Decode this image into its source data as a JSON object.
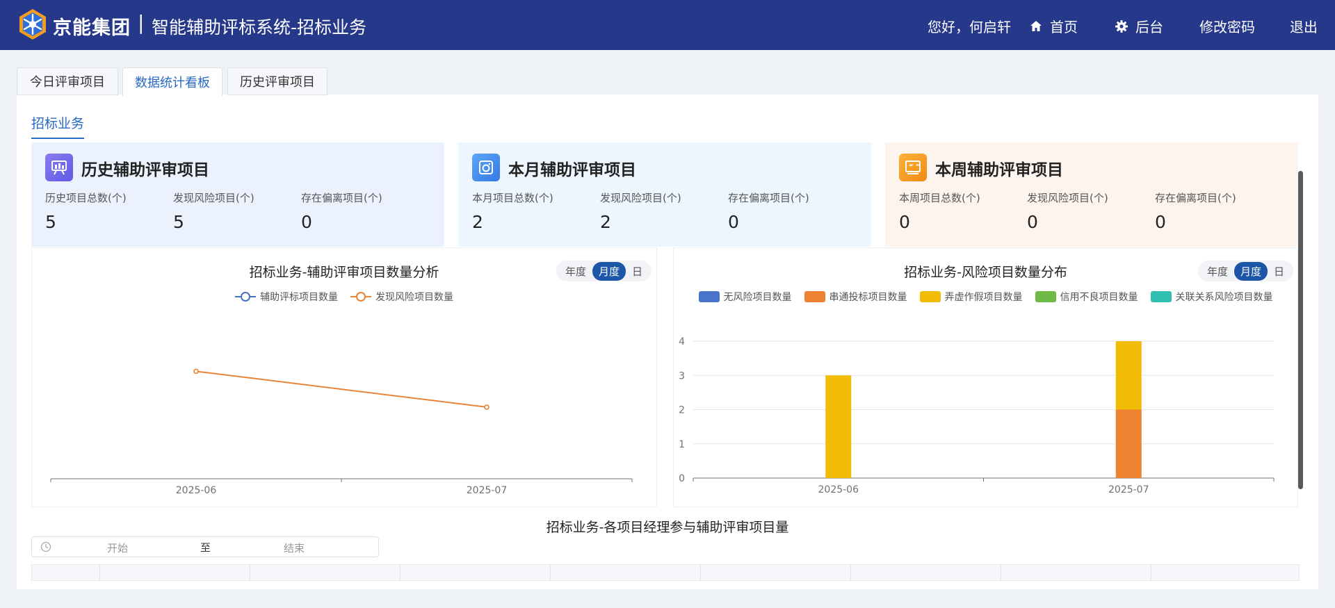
{
  "header": {
    "brand": "京能集团",
    "separator": "|",
    "system_title": "智能辅助评标系统-招标业务",
    "greeting": "您好，何启轩",
    "nav": {
      "home": "首页",
      "admin": "后台",
      "change_password": "修改密码",
      "logout": "退出"
    },
    "bg_color": "#25388a"
  },
  "tabs": [
    {
      "label": "今日评审项目",
      "active": false
    },
    {
      "label": "数据统计看板",
      "active": true
    },
    {
      "label": "历史评审项目",
      "active": false
    }
  ],
  "subtab": "招标业务",
  "stat_cards": [
    {
      "title": "历史辅助评审项目",
      "icon": "presentation-chart-icon",
      "labels": [
        "历史项目总数(个)",
        "发现风险项目(个)",
        "存在偏离项目(个)"
      ],
      "values": [
        "5",
        "5",
        "0"
      ],
      "bg": "#ecf2fd"
    },
    {
      "title": "本月辅助评审项目",
      "icon": "camera-icon",
      "labels": [
        "本月项目总数(个)",
        "发现风险项目(个)",
        "存在偏离项目(个)"
      ],
      "values": [
        "2",
        "2",
        "0"
      ],
      "bg": "#edf5fe"
    },
    {
      "title": "本周辅助评审项目",
      "icon": "quote-card-icon",
      "labels": [
        "本周项目总数(个)",
        "发现风险项目(个)",
        "存在偏离项目(个)"
      ],
      "values": [
        "0",
        "0",
        "0"
      ],
      "bg": "#fef4ee"
    }
  ],
  "period_toggle": {
    "year": "年度",
    "month": "月度",
    "day": "日",
    "selected": "月度"
  },
  "chart_data": [
    {
      "type": "line",
      "title": "招标业务-辅助评审项目数量分析",
      "x": [
        "2025-06",
        "2025-07"
      ],
      "series": [
        {
          "name": "辅助评标项目数量",
          "values": [
            null,
            null
          ],
          "color": "#4a6fc4"
        },
        {
          "name": "发现风险项目数量",
          "values": [
            3,
            2
          ],
          "color": "#e98335"
        }
      ],
      "ylim": [
        0,
        4.5
      ],
      "grid": false,
      "legend": "top-center"
    },
    {
      "type": "bar",
      "stacked": true,
      "title": "招标业务-风险项目数量分布",
      "categories": [
        "2025-06",
        "2025-07"
      ],
      "series": [
        {
          "name": "无风险项目数量",
          "values": [
            0,
            0
          ],
          "color": "#4a74cc"
        },
        {
          "name": "串通投标项目数量",
          "values": [
            0,
            2
          ],
          "color": "#ee8231"
        },
        {
          "name": "弄虚作假项目数量",
          "values": [
            3,
            2
          ],
          "color": "#f2bb06"
        },
        {
          "name": "信用不良项目数量",
          "values": [
            0,
            0
          ],
          "color": "#6dba45"
        },
        {
          "name": "关联关系风险项目数量",
          "values": [
            0,
            0
          ],
          "color": "#30beb0"
        }
      ],
      "yticks": [
        "0",
        "1",
        "2",
        "3",
        "4"
      ],
      "ylim": [
        0,
        4
      ],
      "grid": true,
      "legend": "top-center"
    }
  ],
  "section3": {
    "title": "招标业务-各项目经理参与辅助评审项目量",
    "date_start_placeholder": "开始",
    "date_to": "至",
    "date_end_placeholder": "结束"
  }
}
